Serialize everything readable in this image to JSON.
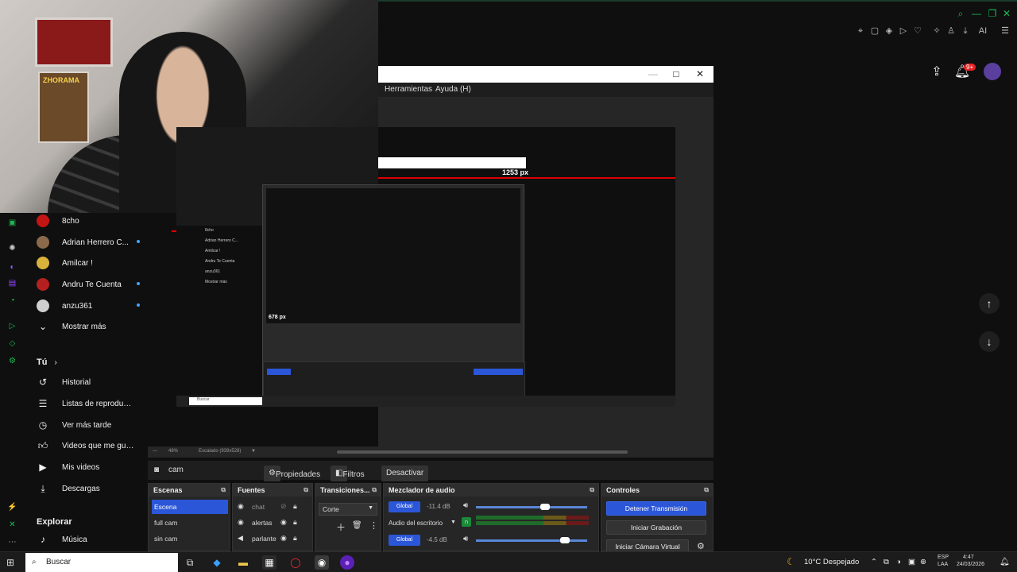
{
  "topbar": {
    "icons": [
      "zoom-icon",
      "minimize-icon",
      "restore-icon",
      "close-icon"
    ],
    "ai_label": "AI"
  },
  "youtube_header": {
    "notification_count": "9+"
  },
  "obs": {
    "menu": {
      "tools": "Herramientas",
      "help": "Ayuda (H)"
    },
    "nested": {
      "px_label": "1253 px",
      "px_label_inner": "678 px",
      "status_zoom": "48%",
      "status_scaled": "Escalado (939x528)"
    },
    "source_toolbar": {
      "source_name": "cam",
      "properties": "Propiedades",
      "filters": "Filtros",
      "deactivate": "Desactivar"
    },
    "scenes": {
      "title": "Escenas",
      "items": [
        {
          "label": "Escena",
          "selected": true
        },
        {
          "label": "full cam",
          "selected": false
        },
        {
          "label": "sin cam",
          "selected": false
        }
      ]
    },
    "sources": {
      "title": "Fuentes",
      "items": [
        {
          "label": "chat"
        },
        {
          "label": "alertas"
        },
        {
          "label": "parlante"
        }
      ]
    },
    "transitions": {
      "title": "Transiciones...",
      "selected": "Corte"
    },
    "mixer": {
      "title": "Mezclador de audio",
      "tracks": [
        {
          "badge": "Global",
          "db": "-11.4 dB",
          "level": 0.62
        },
        {
          "label": "Audio del escritorio"
        },
        {
          "badge": "Global",
          "db": "-4.5 dB",
          "level": 0.8
        }
      ]
    },
    "controls": {
      "title": "Controles",
      "stop_stream": "Detener Transmisión",
      "start_recording": "Iniciar Grabación",
      "start_virtual_cam": "Iniciar Cámara Virtual"
    }
  },
  "youtube_sidebar": {
    "channels": [
      {
        "name": "8cho",
        "live": false,
        "color": "#c41515"
      },
      {
        "name": "Adrian Herrero C...",
        "live": true,
        "color": "#8a6a4a"
      },
      {
        "name": "Amilcar !",
        "live": false,
        "color": "#d9b23a"
      },
      {
        "name": "Andru Te Cuenta",
        "live": true,
        "color": "#b42020"
      },
      {
        "name": "anzu361",
        "live": true,
        "color": "#cfcfcf"
      }
    ],
    "show_more": "Mostrar más",
    "you_title": "Tú",
    "you_items": [
      {
        "label": "Historial",
        "icon": "history-icon"
      },
      {
        "label": "Listas de reproducc...",
        "icon": "playlists-icon"
      },
      {
        "label": "Ver más tarde",
        "icon": "watch-later-icon"
      },
      {
        "label": "Videos que me gus...",
        "icon": "liked-videos-icon"
      },
      {
        "label": "Mis videos",
        "icon": "my-videos-icon"
      },
      {
        "label": "Descargas",
        "icon": "downloads-icon"
      }
    ],
    "explore_title": "Explorar",
    "explore_items": [
      {
        "label": "Música",
        "icon": "music-icon"
      }
    ]
  },
  "taskbar": {
    "search_placeholder": "Buscar",
    "weather": "10°C  Despejado",
    "lang_top": "ESP",
    "lang_bottom": "LAA",
    "time": "4:47",
    "date": "24/03/2026"
  }
}
